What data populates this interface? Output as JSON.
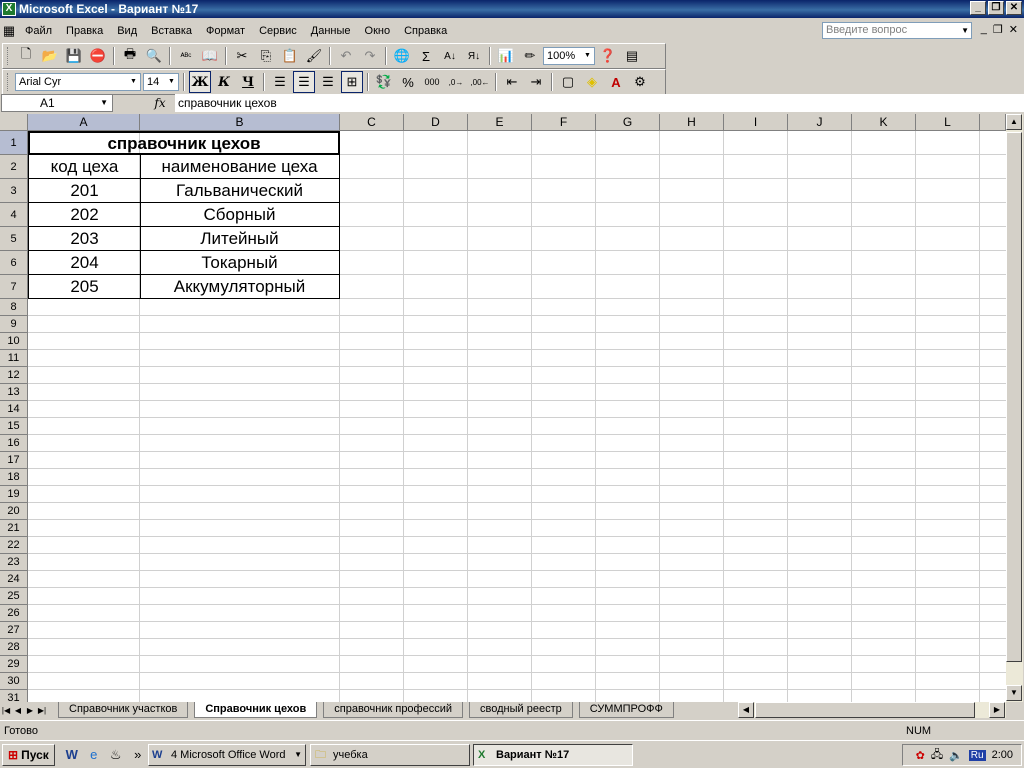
{
  "window": {
    "title": "Microsoft Excel - Вариант №17",
    "app_icon": "excel-icon"
  },
  "menu": [
    "Файл",
    "Правка",
    "Вид",
    "Вставка",
    "Формат",
    "Сервис",
    "Данные",
    "Окно",
    "Справка"
  ],
  "help_search": {
    "placeholder": "Введите вопрос"
  },
  "toolbar_standard": {
    "zoom": "100%"
  },
  "toolbar_format": {
    "font": "Arial Cyr",
    "size": "14",
    "bold": "Ж",
    "italic": "К",
    "underline": "Ч"
  },
  "formula_bar": {
    "name_box": "A1",
    "fx": "fx",
    "value": "справочник цехов"
  },
  "grid": {
    "columns": [
      "A",
      "B",
      "C",
      "D",
      "E",
      "F",
      "G",
      "H",
      "I",
      "J",
      "K",
      "L"
    ],
    "rows": [
      "1",
      "2",
      "3",
      "4",
      "5",
      "6",
      "7",
      "8",
      "9",
      "10",
      "11",
      "12",
      "13",
      "14",
      "15",
      "16",
      "17",
      "18",
      "19",
      "20",
      "21",
      "22",
      "23",
      "24",
      "25",
      "26",
      "27",
      "28",
      "29",
      "30",
      "31"
    ],
    "table": {
      "title": "справочник цехов",
      "headers": [
        "код цеха",
        "наименование цеха"
      ],
      "data": [
        [
          "201",
          "Гальванический"
        ],
        [
          "202",
          "Сборный"
        ],
        [
          "203",
          "Литейный"
        ],
        [
          "204",
          "Токарный"
        ],
        [
          "205",
          "Аккумуляторный"
        ]
      ]
    }
  },
  "sheet_tabs": [
    "Справочник участков",
    "Справочник цехов",
    "справочник профессий",
    "сводный реестр",
    "СУММПРОФФ"
  ],
  "active_tab": "Справочник цехов",
  "status": {
    "ready": "Готово",
    "num": "NUM"
  },
  "taskbar": {
    "start": "Пуск",
    "chevron": "»",
    "tasks": [
      "4 Microsoft Office Word",
      "учебка",
      "Вариант №17"
    ],
    "time": "2:00",
    "lang": "Ru"
  }
}
